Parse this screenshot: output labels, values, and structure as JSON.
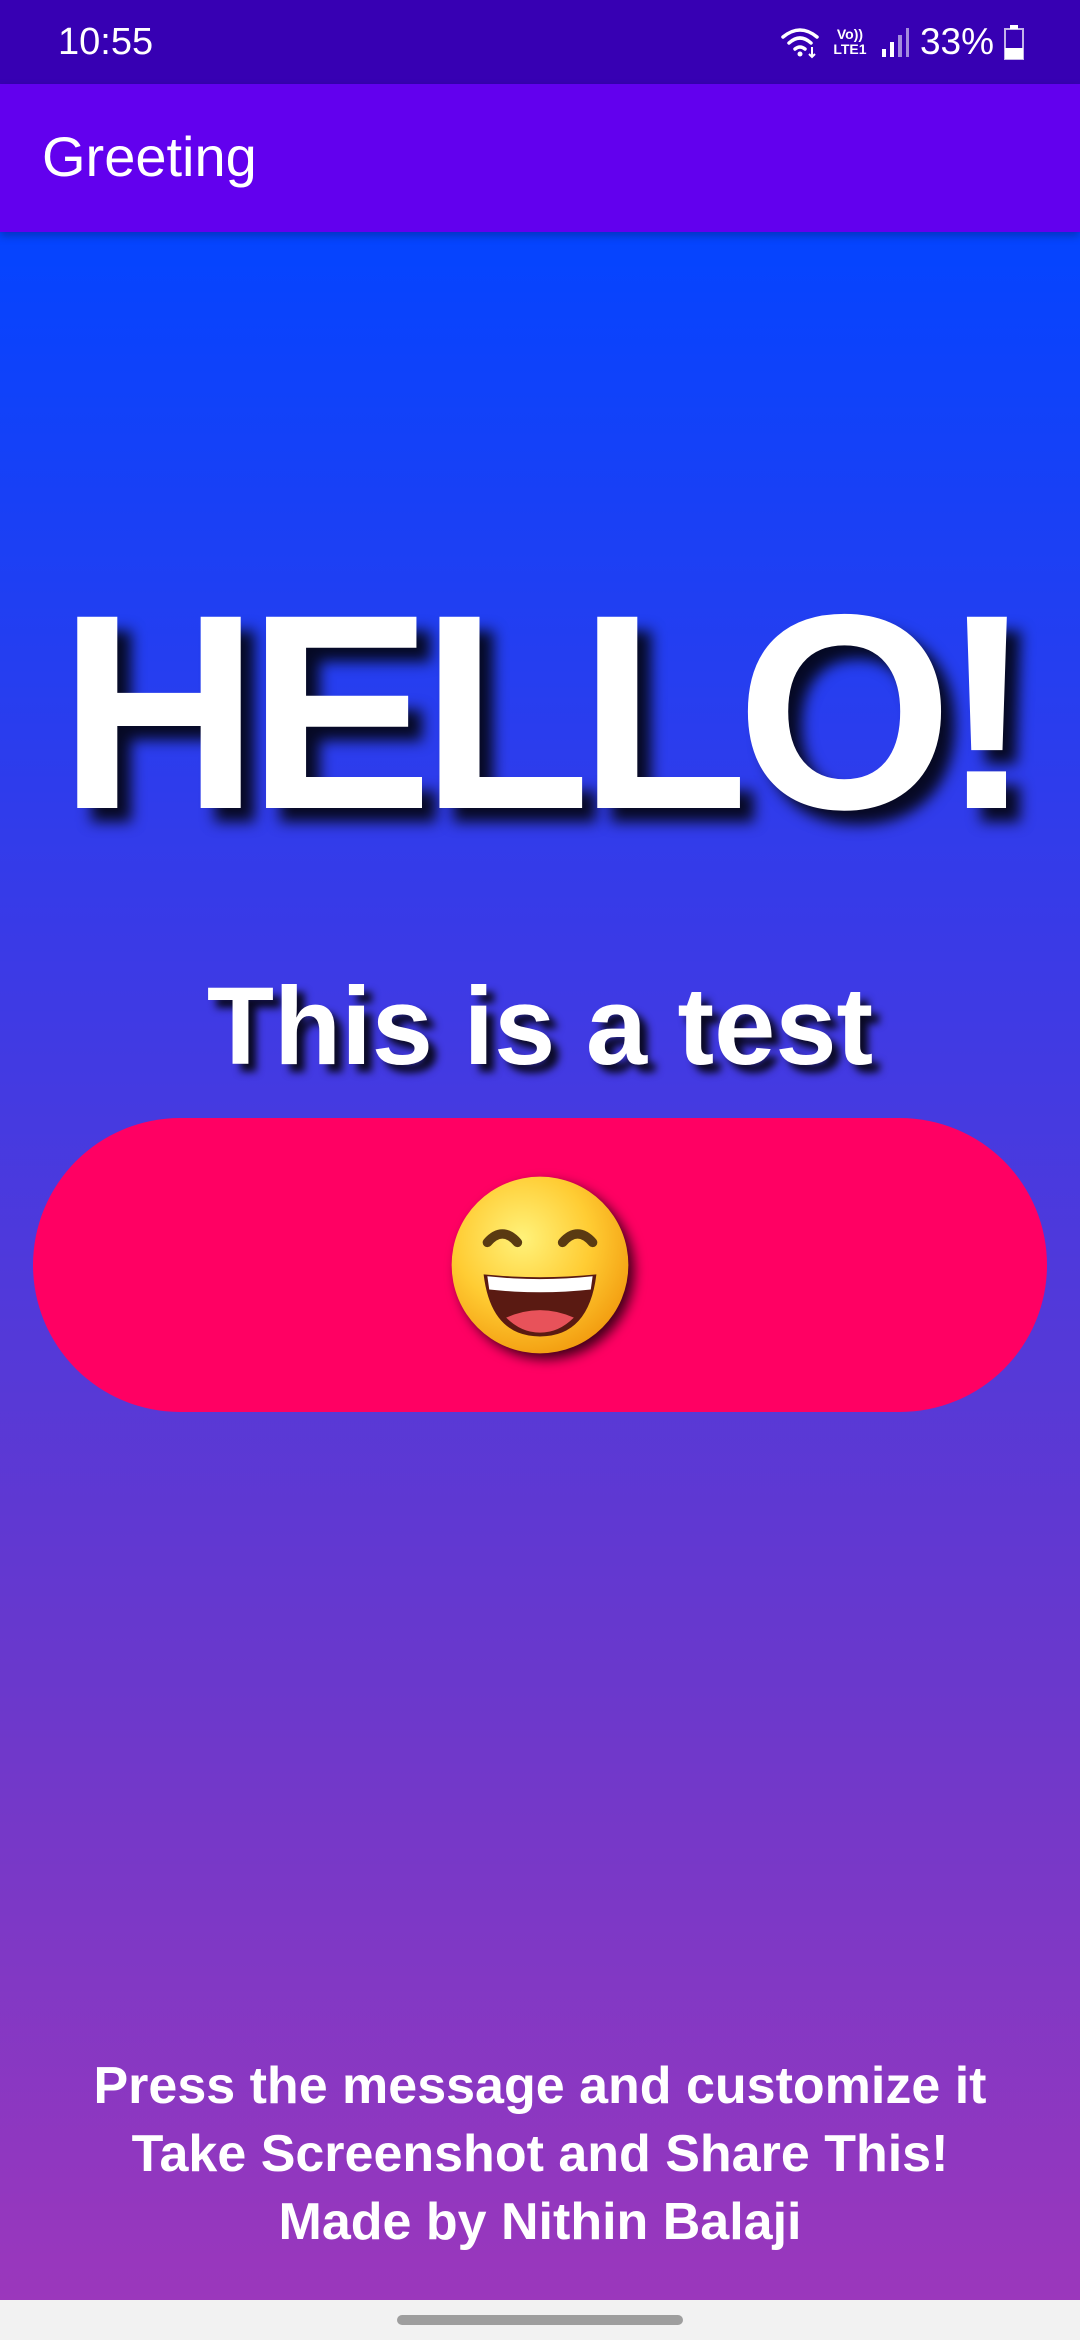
{
  "status_bar": {
    "time": "10:55",
    "network_label_top": "Vo))",
    "network_label_bottom": "LTE1",
    "battery": "33%",
    "icons": [
      "wifi-icon",
      "signal-icon",
      "battery-icon"
    ]
  },
  "app_bar": {
    "title": "Greeting"
  },
  "main": {
    "headline": "HELLO!",
    "subtitle": "This is a test",
    "emoji_button": {
      "icon": "grinning-face-emoji-icon",
      "color": "#ff0063"
    },
    "footer": {
      "line1": "Press the message and customize it",
      "line2": "Take Screenshot and Share This!",
      "line3": "Made by Nithin Balaji"
    }
  },
  "colors": {
    "status_bar": "#3700b3",
    "app_bar": "#6200ee",
    "gradient_top": "#0444ff",
    "gradient_bottom": "#9b37bc",
    "text": "#ffffff"
  }
}
